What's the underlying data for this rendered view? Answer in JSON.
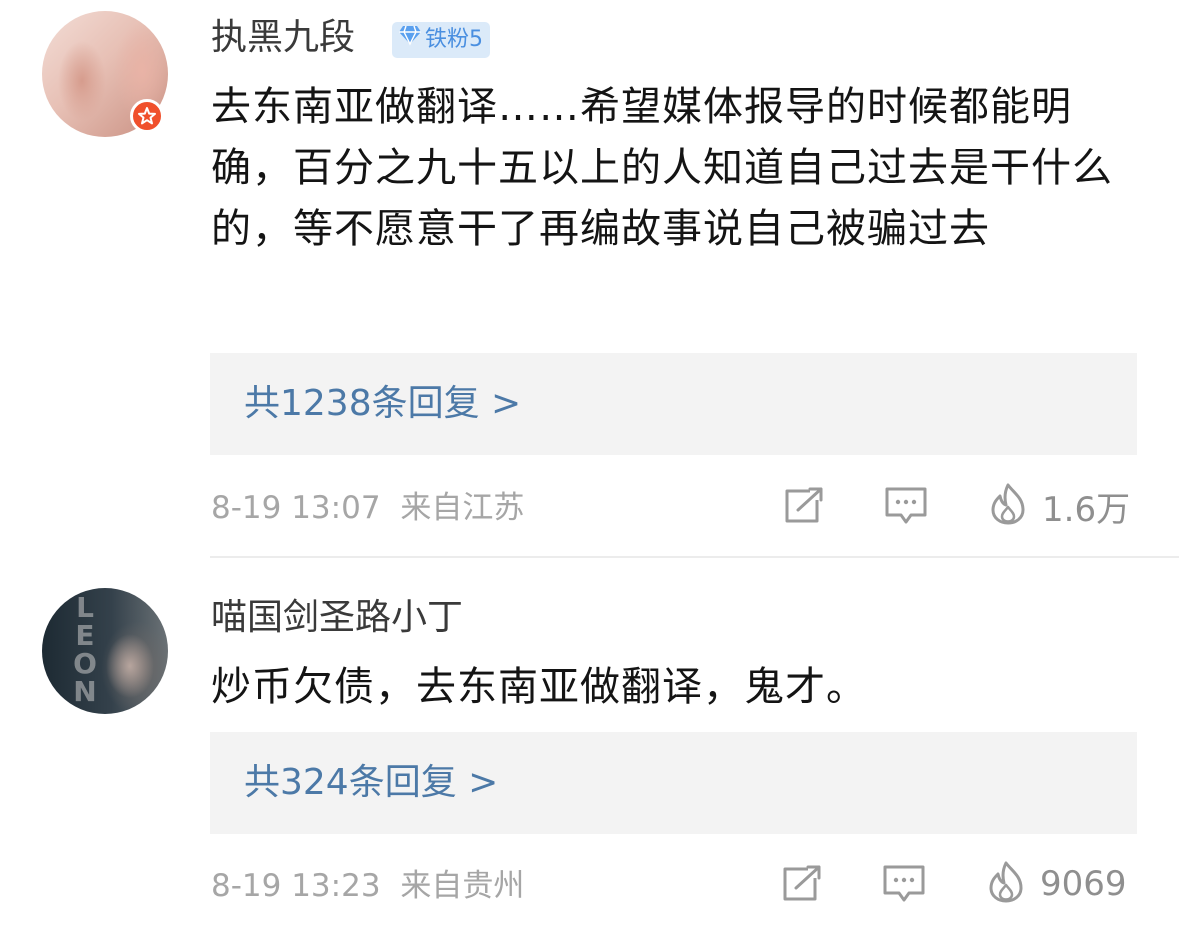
{
  "comments": [
    {
      "username": "执黑九段",
      "fan_badge": "铁粉5",
      "text": "去东南亚做翻译……希望媒体报导的时候都能明确，百分之九十五以上的人知道自己过去是干什么的，等不愿意干了再编故事说自己被骗过去",
      "replies_label": "共1238条回复 >",
      "timestamp": "8-19 13:07",
      "location": "来自江苏",
      "likes": "1.6万",
      "icons": [
        "share-icon",
        "comment-icon",
        "like-flame-icon",
        "vip-star-icon",
        "diamond-icon"
      ]
    },
    {
      "username": "喵国剑圣路小丁",
      "avatar_text": "LEON",
      "text": "炒币欠债，去东南亚做翻译，鬼才。",
      "replies_label": "共324条回复 >",
      "timestamp": "8-19 13:23",
      "location": "来自贵州",
      "likes": "9069",
      "icons": [
        "share-icon",
        "comment-icon",
        "like-flame-icon"
      ]
    }
  ],
  "colors": {
    "link": "#4c79a7",
    "meta": "#a6a6a6",
    "badge_bg": "#dbeaf9",
    "badge_text": "#4a8fe0",
    "vip_badge": "#f0502c",
    "reply_bg": "#f3f3f3"
  }
}
